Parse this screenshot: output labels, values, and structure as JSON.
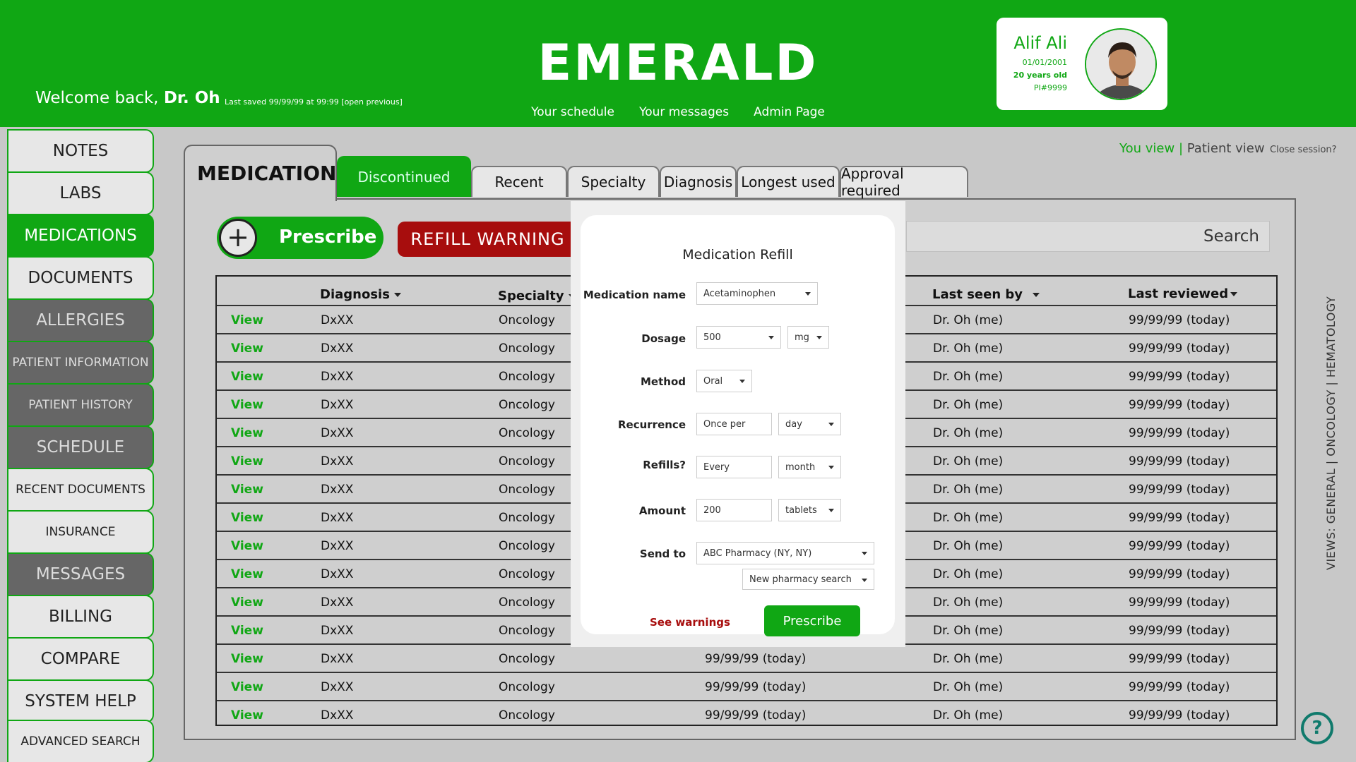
{
  "header": {
    "title": "EMERALD",
    "welcome_prefix": "Welcome back,",
    "welcome_name": "Dr. Oh",
    "last_saved": "Last saved 99/99/99 at 99:99  [open previous]",
    "nav": [
      "Your schedule",
      "Your messages",
      "Admin Page"
    ]
  },
  "patient": {
    "name": "Alif Ali",
    "dob": "01/01/2001",
    "age": "20 years old",
    "id": "PI#9999"
  },
  "sidebar": {
    "items": [
      {
        "label": "NOTES"
      },
      {
        "label": "LABS"
      },
      {
        "label": "MEDICATIONS"
      },
      {
        "label": "DOCUMENTS"
      },
      {
        "label": "ALLERGIES"
      },
      {
        "label": "PATIENT INFORMATION"
      },
      {
        "label": "PATIENT HISTORY"
      },
      {
        "label": "SCHEDULE"
      },
      {
        "label": "RECENT DOCUMENTS"
      },
      {
        "label": "INSURANCE"
      },
      {
        "label": "MESSAGES"
      },
      {
        "label": "BILLING"
      },
      {
        "label": "COMPARE"
      },
      {
        "label": "SYSTEM HELP"
      },
      {
        "label": "ADVANCED SEARCH"
      }
    ]
  },
  "tabs": {
    "main": "MEDICATIONS",
    "items": [
      "Discontinued",
      "Recent",
      "Specialty",
      "Diagnosis",
      "Longest used",
      "Approval required"
    ]
  },
  "view_toggle": {
    "you": "You view",
    "sep": "|",
    "patient": "Patient view"
  },
  "close_session": "Close session?",
  "toolbar": {
    "prescribe": "Prescribe",
    "refill_warning": "REFILL WARNING",
    "search": "Search"
  },
  "table": {
    "headers": {
      "diagnosis": "Diagnosis",
      "specialty": "Specialty",
      "last_seen_by": "Last seen by",
      "last_reviewed": "Last reviewed"
    },
    "rows": [
      {
        "view": "View",
        "diagnosis": "DxXX",
        "specialty": "Oncology",
        "date": "",
        "seen_by": "Dr. Oh (me)",
        "reviewed": "99/99/99 (today)"
      },
      {
        "view": "View",
        "diagnosis": "DxXX",
        "specialty": "Oncology",
        "date": "",
        "seen_by": "Dr. Oh (me)",
        "reviewed": "99/99/99 (today)"
      },
      {
        "view": "View",
        "diagnosis": "DxXX",
        "specialty": "Oncology",
        "date": "",
        "seen_by": "Dr. Oh (me)",
        "reviewed": "99/99/99 (today)"
      },
      {
        "view": "View",
        "diagnosis": "DxXX",
        "specialty": "Oncology",
        "date": "",
        "seen_by": "Dr. Oh (me)",
        "reviewed": "99/99/99 (today)"
      },
      {
        "view": "View",
        "diagnosis": "DxXX",
        "specialty": "Oncology",
        "date": "",
        "seen_by": "Dr. Oh (me)",
        "reviewed": "99/99/99 (today)"
      },
      {
        "view": "View",
        "diagnosis": "DxXX",
        "specialty": "Oncology",
        "date": "",
        "seen_by": "Dr. Oh (me)",
        "reviewed": "99/99/99 (today)"
      },
      {
        "view": "View",
        "diagnosis": "DxXX",
        "specialty": "Oncology",
        "date": "",
        "seen_by": "Dr. Oh (me)",
        "reviewed": "99/99/99 (today)"
      },
      {
        "view": "View",
        "diagnosis": "DxXX",
        "specialty": "Oncology",
        "date": "",
        "seen_by": "Dr. Oh (me)",
        "reviewed": "99/99/99 (today)"
      },
      {
        "view": "View",
        "diagnosis": "DxXX",
        "specialty": "Oncology",
        "date": "",
        "seen_by": "Dr. Oh (me)",
        "reviewed": "99/99/99 (today)"
      },
      {
        "view": "View",
        "diagnosis": "DxXX",
        "specialty": "Oncology",
        "date": "",
        "seen_by": "Dr. Oh (me)",
        "reviewed": "99/99/99 (today)"
      },
      {
        "view": "View",
        "diagnosis": "DxXX",
        "specialty": "Oncology",
        "date": "",
        "seen_by": "Dr. Oh (me)",
        "reviewed": "99/99/99 (today)"
      },
      {
        "view": "View",
        "diagnosis": "DxXX",
        "specialty": "Oncology",
        "date": "",
        "seen_by": "Dr. Oh (me)",
        "reviewed": "99/99/99 (today)"
      },
      {
        "view": "View",
        "diagnosis": "DxXX",
        "specialty": "Oncology",
        "date": "99/99/99 (today)",
        "seen_by": "Dr. Oh (me)",
        "reviewed": "99/99/99 (today)"
      },
      {
        "view": "View",
        "diagnosis": "DxXX",
        "specialty": "Oncology",
        "date": "99/99/99 (today)",
        "seen_by": "Dr. Oh (me)",
        "reviewed": "99/99/99 (today)"
      },
      {
        "view": "View",
        "diagnosis": "DxXX",
        "specialty": "Oncology",
        "date": "99/99/99 (today)",
        "seen_by": "Dr. Oh (me)",
        "reviewed": "99/99/99 (today)"
      }
    ]
  },
  "views_label": "VIEWS: GENERAL  |  ONCOLOGY  |  HEMATOLOGY",
  "help": "?",
  "modal": {
    "title": "Medication Refill",
    "fields": [
      {
        "label": "Medication name",
        "value": "Acetaminophen"
      },
      {
        "label": "Dosage",
        "value": "500",
        "unit": "mg"
      },
      {
        "label": "Method",
        "value": "Oral"
      },
      {
        "label": "Recurrence",
        "value": "Once per",
        "unit": "day"
      },
      {
        "label": "Refills?",
        "value": "Every",
        "unit": "month"
      },
      {
        "label": "Amount",
        "value": "200",
        "unit": "tablets"
      },
      {
        "label": "Send to",
        "value": "ABC Pharmacy (NY, NY)"
      }
    ],
    "new_pharmacy": "New pharmacy search",
    "see_warnings": "See warnings",
    "prescribe": "Prescribe"
  },
  "colors": {
    "brand_green": "#10a714",
    "warning_red": "#a70d0d",
    "sidebar_dark": "#666666"
  }
}
